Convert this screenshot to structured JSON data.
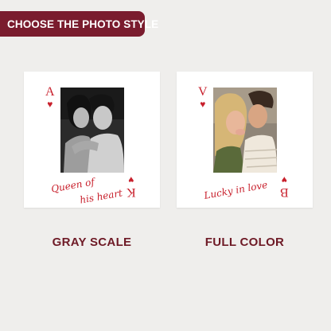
{
  "banner": {
    "title": "CHOOSE THE PHOTO STYLE"
  },
  "colors": {
    "banner_bg": "#7a1c2e",
    "card_red": "#c8202c",
    "label_text": "#6e1a26"
  },
  "options": [
    {
      "label": "GRAY SCALE",
      "corner_top": "A",
      "corner_bottom": "K",
      "suit": "♥",
      "caption_line1": "Queen of",
      "caption_line2": "his heart",
      "photo_style": "grayscale"
    },
    {
      "label": "FULL COLOR",
      "corner_top": "V",
      "corner_bottom": "B",
      "suit": "♥",
      "caption_line1": "Lucky in love",
      "caption_line2": "",
      "photo_style": "color"
    }
  ]
}
